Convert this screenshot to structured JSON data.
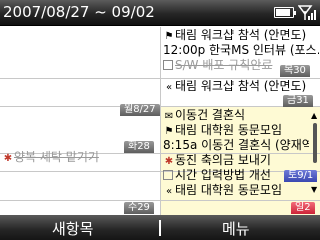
{
  "title": "2007/08/27 ~ 09/02",
  "battery_level": 0.85,
  "days": {
    "mon": {
      "label": "월8/27",
      "rows": [
        {
          "icon": "flag",
          "glyph": "⚑",
          "text": "태림 워크샵 참석 (안면도)",
          "done": false
        },
        {
          "icon": "none",
          "glyph": "",
          "text": "12:00p 한국MS 인터뷰 (포스…",
          "done": false
        },
        {
          "icon": "task",
          "glyph": "",
          "text": "S/W 배포 규칙안료",
          "done": true
        }
      ]
    },
    "thu": {
      "label": "목30",
      "rows": [
        {
          "icon": "double-arrow",
          "glyph": "«",
          "text": "태림 워크샵 참석 (안면도)",
          "done": false
        }
      ]
    },
    "tue": {
      "label": "화28",
      "rows": []
    },
    "fri": {
      "label": "금31",
      "rows": [
        {
          "icon": "birthday",
          "glyph": "✉",
          "text": "이동건 결혼식",
          "done": false
        },
        {
          "icon": "flag",
          "glyph": "⚑",
          "text": "태림 대학원 동문모임",
          "done": false
        },
        {
          "icon": "none",
          "glyph": "",
          "text": "8:15a 이동건 결혼식 (양재역…",
          "done": false
        },
        {
          "icon": "alert",
          "glyph": "✱",
          "text": "동진 축의금 보내기",
          "done": false
        },
        {
          "icon": "task",
          "glyph": "",
          "text": "시간 입력방법 개선",
          "done": false
        },
        {
          "icon": "double-arrow",
          "glyph": "«",
          "text": "태림 대학원 동문모임",
          "done": false
        }
      ]
    },
    "wed": {
      "label": "수29",
      "rows": [
        {
          "icon": "alert",
          "glyph": "✱",
          "text": "양복 세탁 맡기기",
          "done": true
        }
      ]
    },
    "sat": {
      "label": "토9/1"
    },
    "sun": {
      "label": "일2"
    }
  },
  "softkeys": {
    "left": "새항목",
    "right": "메뉴"
  },
  "colors": {
    "sat": "#3a47b0",
    "sun": "#cc2337",
    "today_bg": "#fefad4"
  }
}
